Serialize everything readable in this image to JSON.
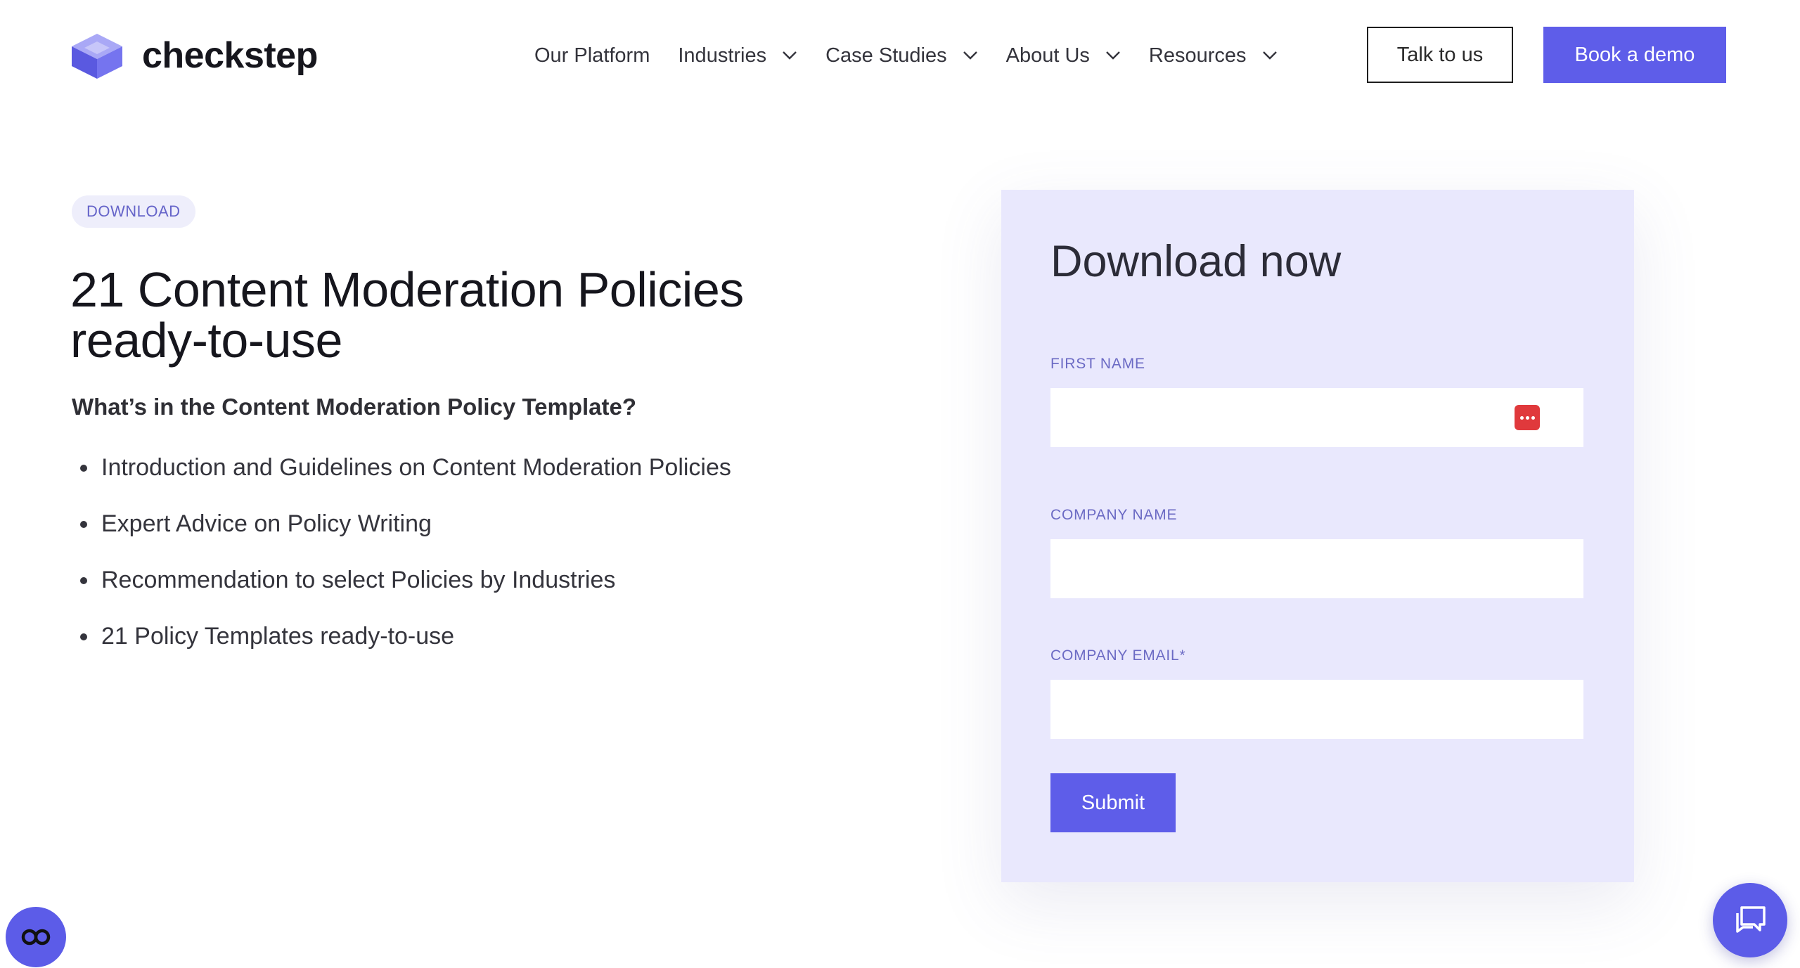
{
  "brand": {
    "name": "checkstep",
    "accent_color": "#5e5de9"
  },
  "nav": {
    "items": [
      {
        "label": "Our Platform",
        "has_dropdown": false
      },
      {
        "label": "Industries",
        "has_dropdown": true
      },
      {
        "label": "Case Studies",
        "has_dropdown": true
      },
      {
        "label": "About Us",
        "has_dropdown": true
      },
      {
        "label": "Resources",
        "has_dropdown": true
      }
    ],
    "talk_label": "Talk to us",
    "demo_label": "Book a demo"
  },
  "hero": {
    "badge": "DOWNLOAD",
    "title": "21 Content Moderation Policies ready-to-use",
    "subtitle": "What’s in the Content Moderation Policy Template?",
    "bullets": [
      "Introduction and Guidelines on Content Moderation Policies",
      "Expert Advice on Policy Writing",
      "Recommendation to select Policies by Industries",
      "21 Policy Templates ready-to-use"
    ]
  },
  "form": {
    "title": "Download now",
    "fields": [
      {
        "label": "FIRST NAME",
        "value": ""
      },
      {
        "label": "COMPANY NAME",
        "value": ""
      },
      {
        "label": "COMPANY EMAIL*",
        "value": ""
      }
    ],
    "submit_label": "Submit",
    "background_color": "#e9e8fd"
  },
  "widgets": {
    "accessibility_icon": "accessibility-icon",
    "chat_icon": "chat-icon"
  }
}
